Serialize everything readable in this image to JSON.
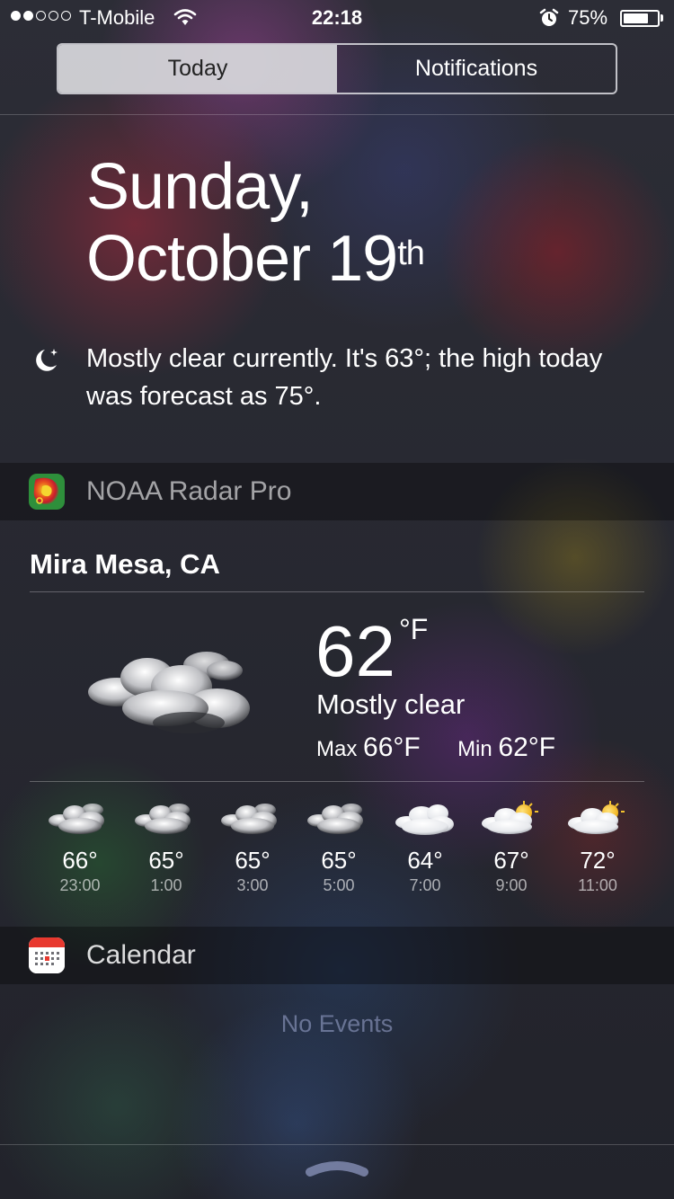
{
  "status_bar": {
    "carrier": "T-Mobile",
    "time": "22:18",
    "battery_percent": "75%",
    "battery_level": 0.75,
    "signal_bars": 2,
    "signal_total": 5
  },
  "tabs": [
    {
      "label": "Today",
      "active": true
    },
    {
      "label": "Notifications",
      "active": false
    }
  ],
  "date": {
    "line1": "Sunday,",
    "line2_main": "October 19",
    "line2_suffix": "th"
  },
  "summary": {
    "icon": "moon-icon",
    "text": "Mostly clear currently. It's 63°; the high today was forecast as 75°."
  },
  "noaa_widget": {
    "app_name": "NOAA Radar Pro",
    "location": "Mira Mesa, CA",
    "current_temp": "62",
    "unit": "°F",
    "condition": "Mostly clear",
    "max_label": "Max",
    "max_value": "66°F",
    "min_label": "Min",
    "min_value": "62°F",
    "hourly": [
      {
        "temp": "66°",
        "time": "23:00",
        "icon": "night-cloud-icon"
      },
      {
        "temp": "65°",
        "time": "1:00",
        "icon": "night-cloud-icon"
      },
      {
        "temp": "65°",
        "time": "3:00",
        "icon": "night-cloud-icon"
      },
      {
        "temp": "65°",
        "time": "5:00",
        "icon": "night-cloud-icon"
      },
      {
        "temp": "64°",
        "time": "7:00",
        "icon": "cloud-icon"
      },
      {
        "temp": "67°",
        "time": "9:00",
        "icon": "partly-sunny-icon"
      },
      {
        "temp": "72°",
        "time": "11:00",
        "icon": "partly-sunny-icon"
      }
    ]
  },
  "calendar_widget": {
    "app_name": "Calendar",
    "empty_text": "No Events"
  },
  "colors": {
    "segment_active_bg": "#d7d7dc",
    "sun": "#f3c22e",
    "muted_text": "#9aa0c8"
  }
}
